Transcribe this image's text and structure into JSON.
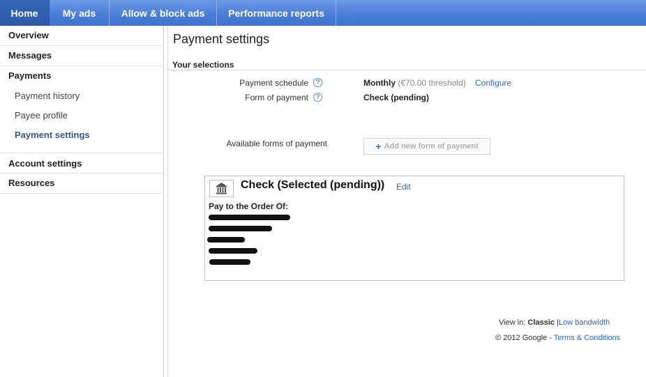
{
  "nav": {
    "tabs": [
      {
        "label": "Home",
        "active": true
      },
      {
        "label": "My ads",
        "active": false
      },
      {
        "label": "Allow & block ads",
        "active": false
      },
      {
        "label": "Performance reports",
        "active": false
      }
    ]
  },
  "sidebar": {
    "items": [
      {
        "label": "Overview"
      },
      {
        "label": "Messages"
      },
      {
        "label": "Payments"
      },
      {
        "label": "Payment history"
      },
      {
        "label": "Payee profile"
      },
      {
        "label": "Payment settings"
      },
      {
        "label": "Account settings"
      },
      {
        "label": "Resources"
      }
    ],
    "active_item": "Payment settings"
  },
  "main": {
    "title": "Payment settings",
    "selections_heading": "Your selections",
    "payment_schedule": {
      "label": "Payment schedule",
      "value": "Monthly",
      "threshold": "(€70.00 threshold)",
      "action": "Configure"
    },
    "form_of_payment": {
      "label": "Form of payment",
      "value": "Check (pending)"
    },
    "available_forms": {
      "label": "Available forms of payment",
      "add_button": "Add new form of payment"
    },
    "check_card": {
      "title": "Check  (Selected (pending))",
      "edit": "Edit",
      "pay_to_label": "Pay to the Order Of:"
    }
  },
  "footer": {
    "view_in_label": "View in:",
    "view_classic": "Classic",
    "separator": "|",
    "low_bandwidth": "Low bandwidth",
    "copyright": "© 2012 Google",
    "dash": "-",
    "terms": "Terms & Conditions"
  },
  "colors": {
    "nav_bg": "#4a7fd9",
    "nav_active": "#2a5aa6",
    "link": "#2a6ab5",
    "active_sidebar": "#2f5a9a"
  }
}
